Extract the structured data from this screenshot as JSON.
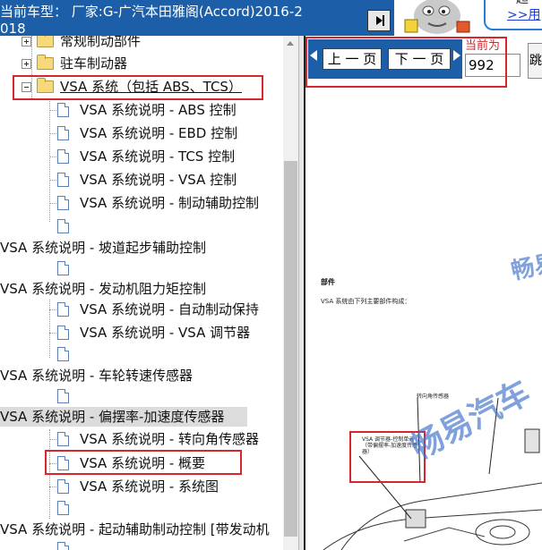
{
  "header": {
    "title": "当前车型： 厂家:G-广汽本田雅阁(Accord)2016-2018",
    "toggle_icon": "play-pause-icon"
  },
  "promo": {
    "top_text": "超",
    "link": ">>用"
  },
  "tree": {
    "items": [
      {
        "label": "常规制动部件",
        "icon": "folder-icon",
        "expander": "plus"
      },
      {
        "label": "驻车制动器",
        "icon": "folder-icon",
        "expander": "plus"
      },
      {
        "label": "VSA 系统（包括 ABS、TCS）",
        "icon": "folder-open-icon",
        "expander": "minus"
      },
      {
        "label": "VSA 系统说明 - ABS 控制",
        "icon": "document-icon"
      },
      {
        "label": "VSA 系统说明 - EBD 控制",
        "icon": "document-icon"
      },
      {
        "label": "VSA 系统说明 - TCS 控制",
        "icon": "document-icon"
      },
      {
        "label": "VSA 系统说明 - VSA 控制",
        "icon": "document-icon"
      },
      {
        "label": "VSA 系统说明 - 制动辅助控制",
        "icon": "document-icon"
      },
      {
        "label": "VSA 系统说明 - 坡道起步辅助控制",
        "icon": "document-icon"
      },
      {
        "label": "VSA 系统说明 - 发动机阻力矩控制",
        "icon": "document-icon"
      },
      {
        "label": "VSA 系统说明 - 自动制动保持",
        "icon": "document-icon"
      },
      {
        "label": "VSA 系统说明 - VSA 调节器",
        "icon": "document-icon"
      },
      {
        "label": "VSA 系统说明 - 车轮转速传感器",
        "icon": "document-icon"
      },
      {
        "label": "VSA 系统说明 - 偏摆率-加速度传感器",
        "icon": "document-icon"
      },
      {
        "label": "VSA 系统说明 - 转向角传感器",
        "icon": "document-icon"
      },
      {
        "label": "VSA 系统说明 - 概要",
        "icon": "document-icon"
      },
      {
        "label": "VSA 系统说明 - 系统图",
        "icon": "document-icon"
      },
      {
        "label": "VSA 系统说明 - 起动辅助制动控制 [带发动机",
        "icon": "document-icon"
      }
    ]
  },
  "nav": {
    "prev_label": "上 一 页",
    "next_label": "下 一 页",
    "page_label": "当前为",
    "page_value": "992",
    "go_label": "跳"
  },
  "document": {
    "section_title": "部件",
    "section_desc": "VSA 系统由下列主要部件构成：",
    "callout_1": "VSA 调节器-控制单元（带偏摆率-加速度传感器）",
    "callout_2": "转向角传感器",
    "watermark_1": "畅易",
    "watermark_2": "畅易汽车"
  },
  "colors": {
    "header_blue": "#1c5fa8",
    "highlight_red": "#d9262c",
    "folder_yellow": "#f6d97a",
    "watermark_blue": "#3c6ec8"
  }
}
